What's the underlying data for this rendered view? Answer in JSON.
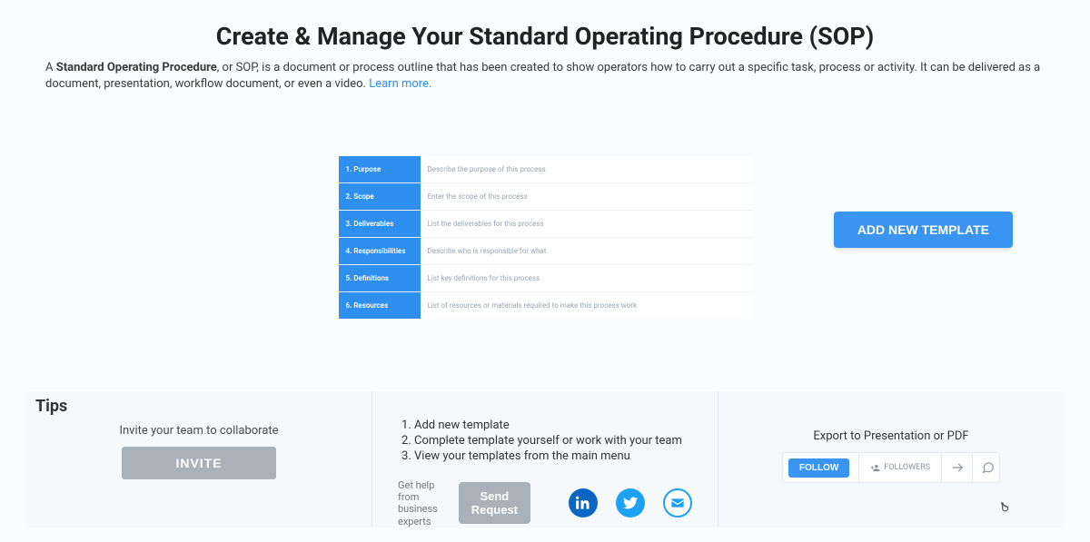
{
  "header": {
    "title": "Create & Manage Your Standard Operating Procedure (SOP)",
    "intro_prefix": "A ",
    "intro_bold": "Standard Operating Procedure",
    "intro_rest": ", or SOP, is a document or process outline that has been created to show operators how to carry out a specific task, process or activity. It can be delivered as a document, presentation, workflow document, or even a video. ",
    "learn_more": "Learn more."
  },
  "template": {
    "rows": [
      {
        "label": "1. Purpose",
        "hint": "Describe the purpose of this process"
      },
      {
        "label": "2. Scope",
        "hint": "Enter the scope of this process"
      },
      {
        "label": "3. Deliverables",
        "hint": "List the deliverables for this process"
      },
      {
        "label": "4. Responsibilities",
        "hint": "Describe who is responsible for what"
      },
      {
        "label": "5. Definitions",
        "hint": "List key definitions for this process"
      },
      {
        "label": "6. Resources",
        "hint": "List of resources or materials required to make this process work"
      }
    ]
  },
  "actions": {
    "add_template": "ADD NEW TEMPLATE"
  },
  "tips": {
    "title": "Tips",
    "col1_text": "Invite your team to collaborate",
    "invite": "INVITE",
    "steps": [
      "Add new template",
      "Complete template yourself or work with your team",
      "View your templates from the main menu"
    ],
    "help_text": "Get help from business experts",
    "send_request": "Send Request",
    "export_title": "Export to Presentation or PDF",
    "follow": "FOLLOW",
    "followers": "FOLLOWERS"
  }
}
